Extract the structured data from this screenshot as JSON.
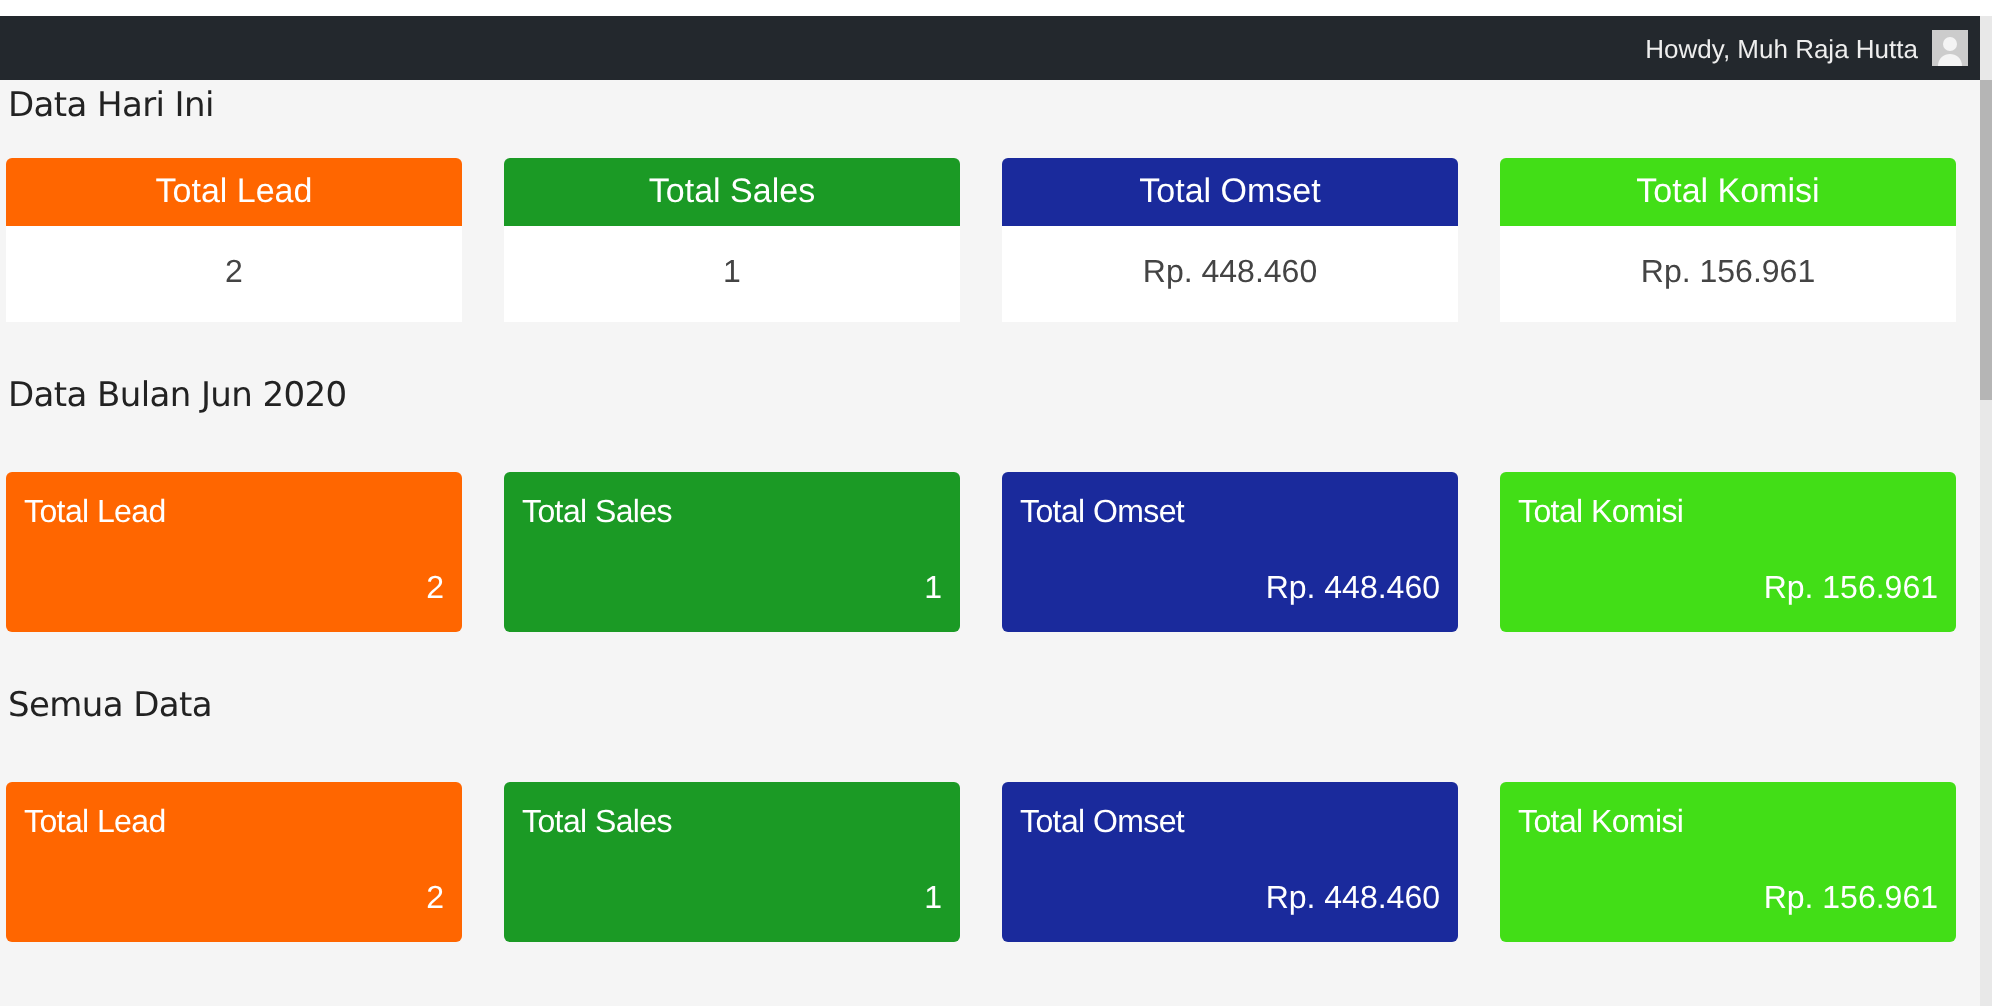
{
  "admin_bar": {
    "greeting": "Howdy, Muh Raja Hutta"
  },
  "sections": [
    {
      "title": "Data Hari Ini",
      "kind": "header",
      "cards": [
        {
          "label": "Total Lead",
          "value": "2",
          "color": "#ff6600"
        },
        {
          "label": "Total Sales",
          "value": "1",
          "color": "#1b9a25"
        },
        {
          "label": "Total Omset",
          "value": "Rp. 448.460",
          "color": "#1a2a9c"
        },
        {
          "label": "Total Komisi",
          "value": "Rp. 156.961",
          "color": "#42de17"
        }
      ]
    },
    {
      "title": "Data Bulan Jun 2020",
      "kind": "tile",
      "cards": [
        {
          "label": "Total Lead",
          "value": "2",
          "color": "#ff6600"
        },
        {
          "label": "Total Sales",
          "value": "1",
          "color": "#1b9a25"
        },
        {
          "label": "Total Omset",
          "value": "Rp. 448.460",
          "color": "#1a2a9c"
        },
        {
          "label": "Total Komisi",
          "value": "Rp. 156.961",
          "color": "#42de17"
        }
      ]
    },
    {
      "title": "Semua Data",
      "kind": "tile",
      "cards": [
        {
          "label": "Total Lead",
          "value": "2",
          "color": "#ff6600"
        },
        {
          "label": "Total Sales",
          "value": "1",
          "color": "#1b9a25"
        },
        {
          "label": "Total Omset",
          "value": "Rp. 448.460",
          "color": "#1a2a9c"
        },
        {
          "label": "Total Komisi",
          "value": "Rp. 156.961",
          "color": "#42de17"
        }
      ]
    }
  ]
}
